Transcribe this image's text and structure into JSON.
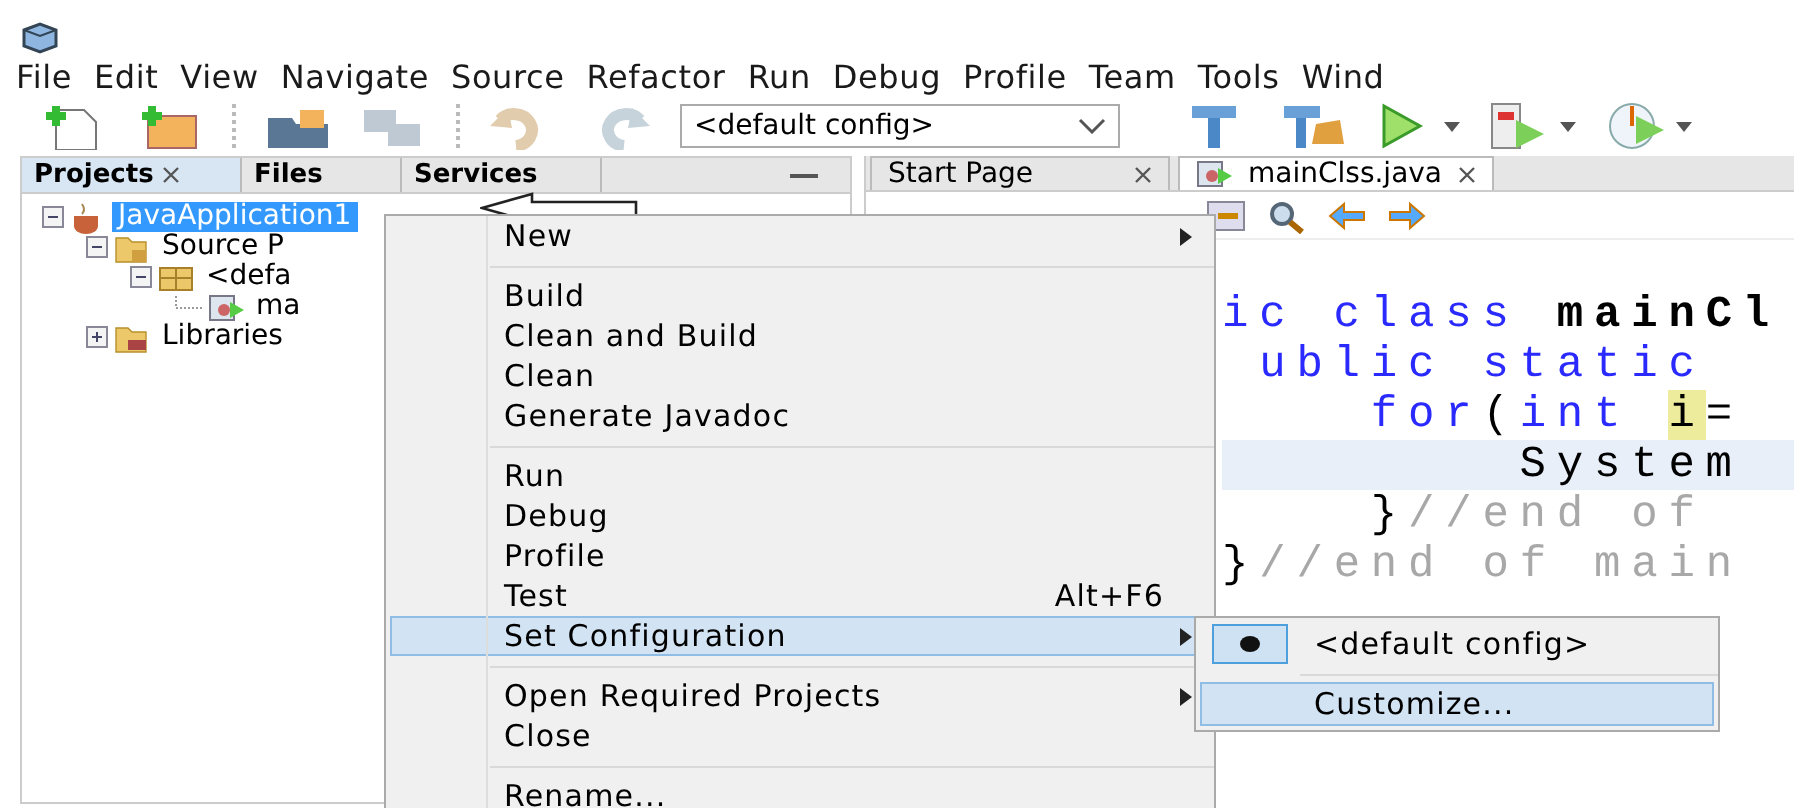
{
  "menu_bar": [
    "File",
    "Edit",
    "View",
    "Navigate",
    "Source",
    "Refactor",
    "Run",
    "Debug",
    "Profile",
    "Team",
    "Tools",
    "Wind"
  ],
  "toolbar": {
    "buttons": [
      {
        "kind": "new-file",
        "disabled": false
      },
      {
        "kind": "new-project",
        "disabled": false
      },
      {
        "kind": "open-project",
        "disabled": false
      },
      {
        "kind": "close-project",
        "disabled": true
      },
      {
        "kind": "undo",
        "disabled": true
      },
      {
        "kind": "redo",
        "disabled": true
      }
    ],
    "config_select": {
      "value": "<default config>"
    },
    "run_buttons": [
      {
        "kind": "build",
        "dropdown": false
      },
      {
        "kind": "clean-build",
        "dropdown": false
      },
      {
        "kind": "run",
        "dropdown": true
      },
      {
        "kind": "debug",
        "dropdown": true
      },
      {
        "kind": "profile",
        "dropdown": true
      }
    ]
  },
  "projects_panel": {
    "tabs": [
      {
        "label": "Projects",
        "selected": true,
        "closable": true
      },
      {
        "label": "Files",
        "selected": false,
        "closable": false
      },
      {
        "label": "Services",
        "selected": false,
        "closable": false
      }
    ],
    "tree": [
      {
        "label": "JavaApplication1",
        "kind": "project",
        "selected": true,
        "expanded": true,
        "children": [
          {
            "label": "Source P",
            "kind": "source-folder",
            "selected": false,
            "expanded": true,
            "children": [
              {
                "label": "<defa",
                "kind": "package",
                "selected": false,
                "expanded": true,
                "children": [
                  {
                    "label": "ma",
                    "kind": "java-file",
                    "selected": false
                  }
                ]
              }
            ]
          },
          {
            "label": "Libraries",
            "kind": "library-folder",
            "selected": false,
            "expanded": false
          }
        ]
      }
    ]
  },
  "editor": {
    "tabs": [
      {
        "label": "Start Page",
        "selected": false
      },
      {
        "label": "mainClss.java",
        "selected": true
      }
    ],
    "code_lines": [
      {
        "kind": "top",
        "current": false,
        "tokens": [
          {
            "text": "ic class ",
            "kind": "keyword"
          },
          {
            "text": "mainCl",
            "kind": "bold"
          }
        ]
      },
      {
        "kind": "sub",
        "current": false,
        "tokens": [
          {
            "text": "ublic static",
            "kind": "keyword"
          }
        ]
      },
      {
        "kind": "block",
        "current": false,
        "tokens": [
          {
            "text": "for",
            "kind": "keyword"
          },
          {
            "text": "(",
            "kind": "plain"
          },
          {
            "text": "int ",
            "kind": "keyword"
          },
          {
            "text": "i",
            "kind": "mark"
          },
          {
            "text": "=",
            "kind": "plain"
          }
        ]
      },
      {
        "kind": "inner",
        "current": true,
        "tokens": [
          {
            "text": "System",
            "kind": "plain"
          }
        ]
      },
      {
        "kind": "block",
        "current": false,
        "tokens": [
          {
            "text": "}",
            "kind": "plain"
          },
          {
            "text": "//end of",
            "kind": "comment"
          }
        ]
      },
      {
        "kind": "top",
        "current": false,
        "tokens": [
          {
            "text": "}",
            "kind": "plain"
          },
          {
            "text": "//end of main",
            "kind": "comment"
          }
        ]
      }
    ]
  },
  "context_menu": {
    "groups": [
      [
        {
          "label": "New",
          "submenu": true,
          "selected": false
        }
      ],
      [
        {
          "label": "Build",
          "submenu": false,
          "selected": false
        },
        {
          "label": "Clean and Build",
          "submenu": false,
          "selected": false
        },
        {
          "label": "Clean",
          "submenu": false,
          "selected": false
        },
        {
          "label": "Generate Javadoc",
          "submenu": false,
          "selected": false
        }
      ],
      [
        {
          "label": "Run",
          "submenu": false,
          "selected": false
        },
        {
          "label": "Debug",
          "submenu": false,
          "selected": false
        },
        {
          "label": "Profile",
          "submenu": false,
          "selected": false
        },
        {
          "label": "Test",
          "shortcut": "Alt+F6",
          "submenu": false,
          "selected": false
        },
        {
          "label": "Set Configuration",
          "submenu": true,
          "selected": true
        }
      ],
      [
        {
          "label": "Open Required Projects",
          "submenu": true,
          "selected": false
        },
        {
          "label": "Close",
          "submenu": false,
          "selected": false
        }
      ],
      [
        {
          "label": "Rename...",
          "submenu": false,
          "selected": false
        }
      ]
    ]
  },
  "submenu": {
    "groups": [
      [
        {
          "label": "<default config>",
          "checked": true,
          "selected": false
        }
      ],
      [
        {
          "label": "Customize...",
          "checked": false,
          "selected": true
        }
      ]
    ]
  }
}
